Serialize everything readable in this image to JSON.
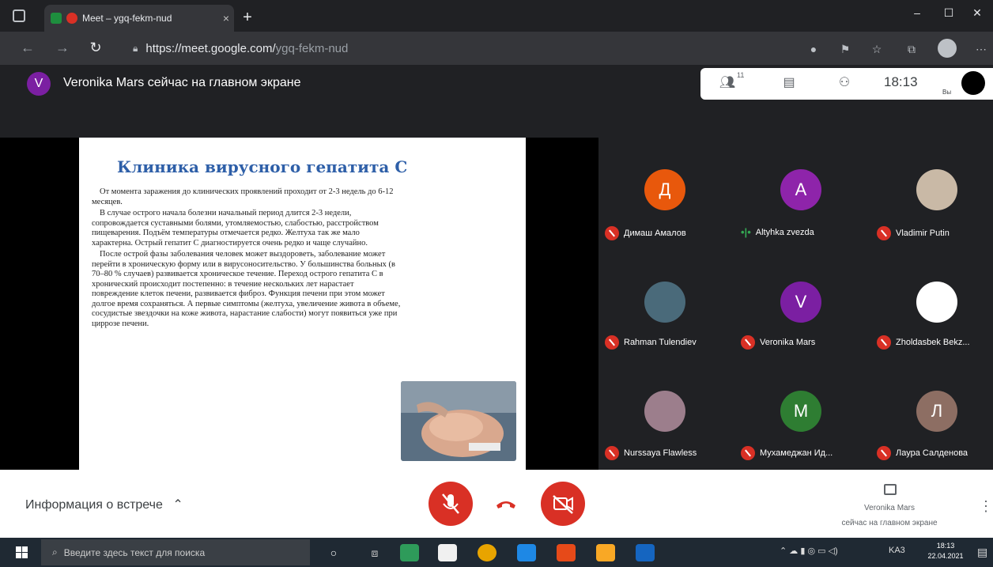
{
  "browser": {
    "tab_title": "Meet – ygq-fekm-nud",
    "tab_close": "×",
    "new_tab": "+",
    "url_host": "https://meet.google.com/",
    "url_path": "ygq-fekm-nud",
    "window_controls": {
      "minimize": "–",
      "maximize": "☐",
      "close": "✕"
    }
  },
  "meet": {
    "presenter_initial": "V",
    "presenter_text": "Veronika Mars сейчас на главном экране",
    "participant_count": "11",
    "time": "18:13",
    "you_label": "Вы",
    "meeting_info": "Информация о встрече",
    "presenting_name": "Veronika Mars",
    "presenting_sub": "сейчас на главном экране"
  },
  "slide": {
    "title": "Клиника вирусного гепатита С",
    "paragraphs": [
      "От момента заражения до клинических проявлений проходит от 2-3 недель до 6-12 месяцев.",
      "В случае острого начала болезни начальный период длится 2-3 недели, сопровождается суставными болями, утомляемостью, слабостью, расстройством пищеварения. Подъём температуры отмечается редко. Желтуха так же мало характерна. Острый гепатит С диагностируется очень редко и чаще случайно.",
      "После острой фазы заболевания человек может выздороветь, заболевание может перейти в хроническую форму или в вирусоносительство. У большинства больных (в 70–80 % случаев) развивается хроническое течение. Переход острого гепатита С в хронический происходит постепенно: в течение нескольких лет нарастает повреждение клеток печени, развивается фиброз. Функция печени при этом может долгое время сохраняться. А первые симптомы (желтуха, увеличение живота в объеме, сосудистые звездочки на коже живота, нарастание слабости) могут появиться уже при циррозе печени."
    ]
  },
  "participants": [
    {
      "initial": "Д",
      "name": "Димаш Амалов",
      "color": "#e8580c",
      "muted": true
    },
    {
      "initial": "A",
      "name": "Altyhka zvezda",
      "color": "#8e24aa",
      "muted": false
    },
    {
      "initial": "",
      "name": "Vladimir Putin",
      "color": "#c9b9a6",
      "muted": true
    },
    {
      "initial": "",
      "name": "Rahman Tulendiev",
      "color": "#4a6a7a",
      "muted": true
    },
    {
      "initial": "V",
      "name": "Veronika Mars",
      "color": "#7b1fa2",
      "muted": true
    },
    {
      "initial": "",
      "name": "Zholdasbek Bekz...",
      "color": "#ffffff",
      "muted": true
    },
    {
      "initial": "",
      "name": "Nurssaya Flawless",
      "color": "#9c7e8c",
      "muted": true
    },
    {
      "initial": "M",
      "name": "Мухамеджан Ид...",
      "color": "#2e7d32",
      "muted": true
    },
    {
      "initial": "Л",
      "name": "Лаура Салденова",
      "color": "#8d6e63",
      "muted": true
    }
  ],
  "taskbar": {
    "search_placeholder": "Введите здесь текст для поиска",
    "lang": "KA3",
    "time": "18:13",
    "date": "22.04.2021"
  },
  "icons": {
    "colors": {
      "accent_red": "#d93025",
      "meet_dark": "#202124",
      "slide_title": "#2e5fa8"
    }
  }
}
